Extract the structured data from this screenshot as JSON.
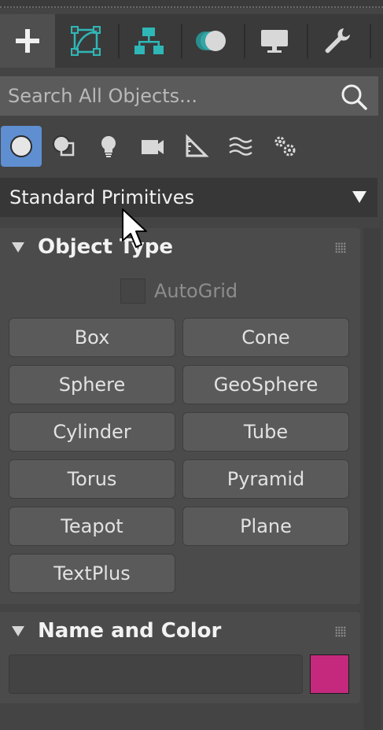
{
  "command_panel": {
    "tabs": [
      {
        "name": "create",
        "icon": "plus-icon",
        "active": true
      },
      {
        "name": "modify",
        "icon": "modify-curve-icon",
        "active": false
      },
      {
        "name": "hierarchy",
        "icon": "hierarchy-icon",
        "active": false
      },
      {
        "name": "motion",
        "icon": "motion-icon",
        "active": false
      },
      {
        "name": "display",
        "icon": "display-monitor-icon",
        "active": false
      },
      {
        "name": "utilities",
        "icon": "wrench-icon",
        "active": false
      }
    ]
  },
  "search": {
    "placeholder": "Search All Objects...",
    "icon": "search-icon"
  },
  "categories": [
    {
      "name": "geometry",
      "icon": "sphere-icon",
      "active": true
    },
    {
      "name": "shapes",
      "icon": "shapes-icon",
      "active": false
    },
    {
      "name": "lights",
      "icon": "light-bulb-icon",
      "active": false
    },
    {
      "name": "cameras",
      "icon": "camera-icon",
      "active": false
    },
    {
      "name": "helpers",
      "icon": "helper-ruler-icon",
      "active": false
    },
    {
      "name": "space-warps",
      "icon": "space-warp-icon",
      "active": false
    },
    {
      "name": "systems",
      "icon": "gears-icon",
      "active": false
    }
  ],
  "primitive_type": {
    "selected": "Standard Primitives"
  },
  "object_type": {
    "title": "Object Type",
    "autogrid_label": "AutoGrid",
    "buttons": [
      "Box",
      "Cone",
      "Sphere",
      "GeoSphere",
      "Cylinder",
      "Tube",
      "Torus",
      "Pyramid",
      "Teapot",
      "Plane",
      "TextPlus"
    ]
  },
  "name_and_color": {
    "title": "Name and Color",
    "name_value": "",
    "color": "#c4297e"
  },
  "colors": {
    "accent": "#5f8fd1",
    "icon_teal": "#2fb7b7",
    "panel_bg": "#444444"
  }
}
